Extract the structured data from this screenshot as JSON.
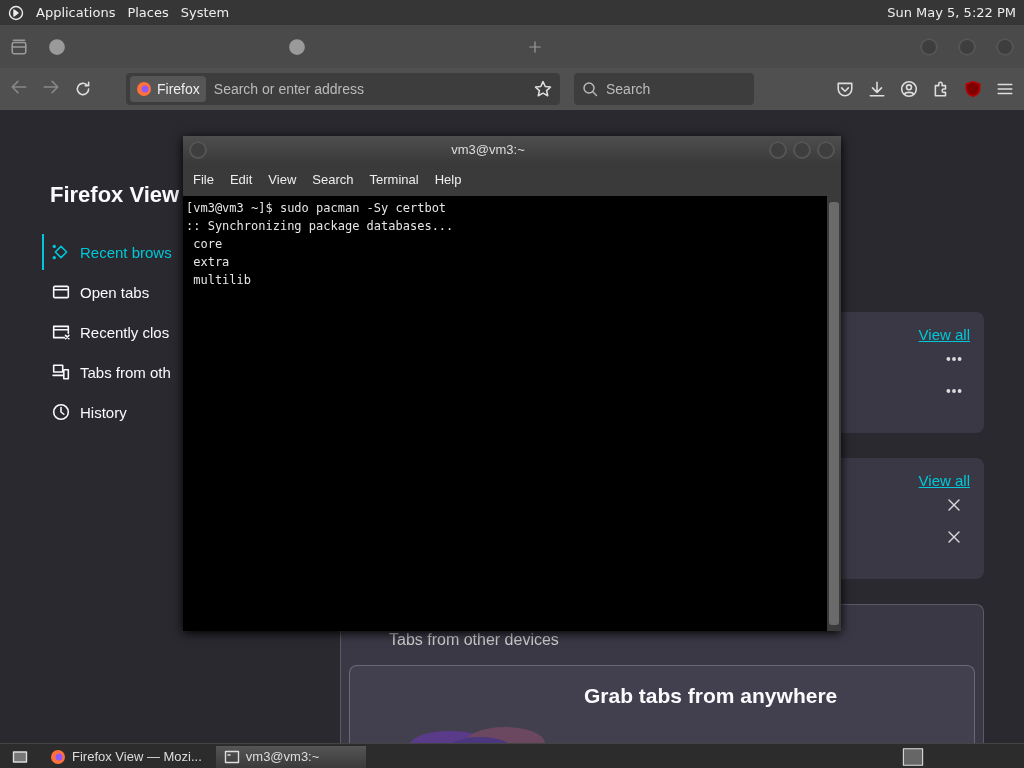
{
  "top_panel": {
    "menus": [
      "Applications",
      "Places",
      "System"
    ],
    "clock": "Sun May 5, 5:22 PM"
  },
  "browser": {
    "address_bar": {
      "identity": "Firefox",
      "placeholder": "Search or enter address"
    },
    "search_field": {
      "placeholder": "Search"
    }
  },
  "firefox_view": {
    "title": "Firefox View",
    "nav": [
      {
        "label": "Recent brows",
        "kind": "recent",
        "selected": true
      },
      {
        "label": "Open tabs",
        "kind": "open",
        "selected": false
      },
      {
        "label": "Recently clos",
        "kind": "closed",
        "selected": false
      },
      {
        "label": "Tabs from oth",
        "kind": "devices",
        "selected": false
      },
      {
        "label": "History",
        "kind": "history",
        "selected": false
      }
    ],
    "cards": [
      {
        "link": "View all",
        "rows": [
          {
            "kind": "more"
          },
          {
            "kind": "more"
          }
        ]
      },
      {
        "link": "View all",
        "rows": [
          {
            "kind": "close"
          },
          {
            "kind": "close"
          }
        ]
      }
    ],
    "devices_card": {
      "title": "Tabs from other devices",
      "promo_heading": "Grab tabs from anywhere"
    }
  },
  "terminal": {
    "title": "vm3@vm3:~",
    "menus": [
      "File",
      "Edit",
      "View",
      "Search",
      "Terminal",
      "Help"
    ],
    "lines": [
      "[vm3@vm3 ~]$ sudo pacman -Sy certbot",
      ":: Synchronizing package databases...",
      " core",
      " extra",
      " multilib"
    ]
  },
  "taskbar": {
    "tasks": [
      {
        "label": "Firefox View — Mozi...",
        "kind": "firefox",
        "selected": false
      },
      {
        "label": "vm3@vm3:~",
        "kind": "terminal",
        "selected": true
      }
    ]
  }
}
